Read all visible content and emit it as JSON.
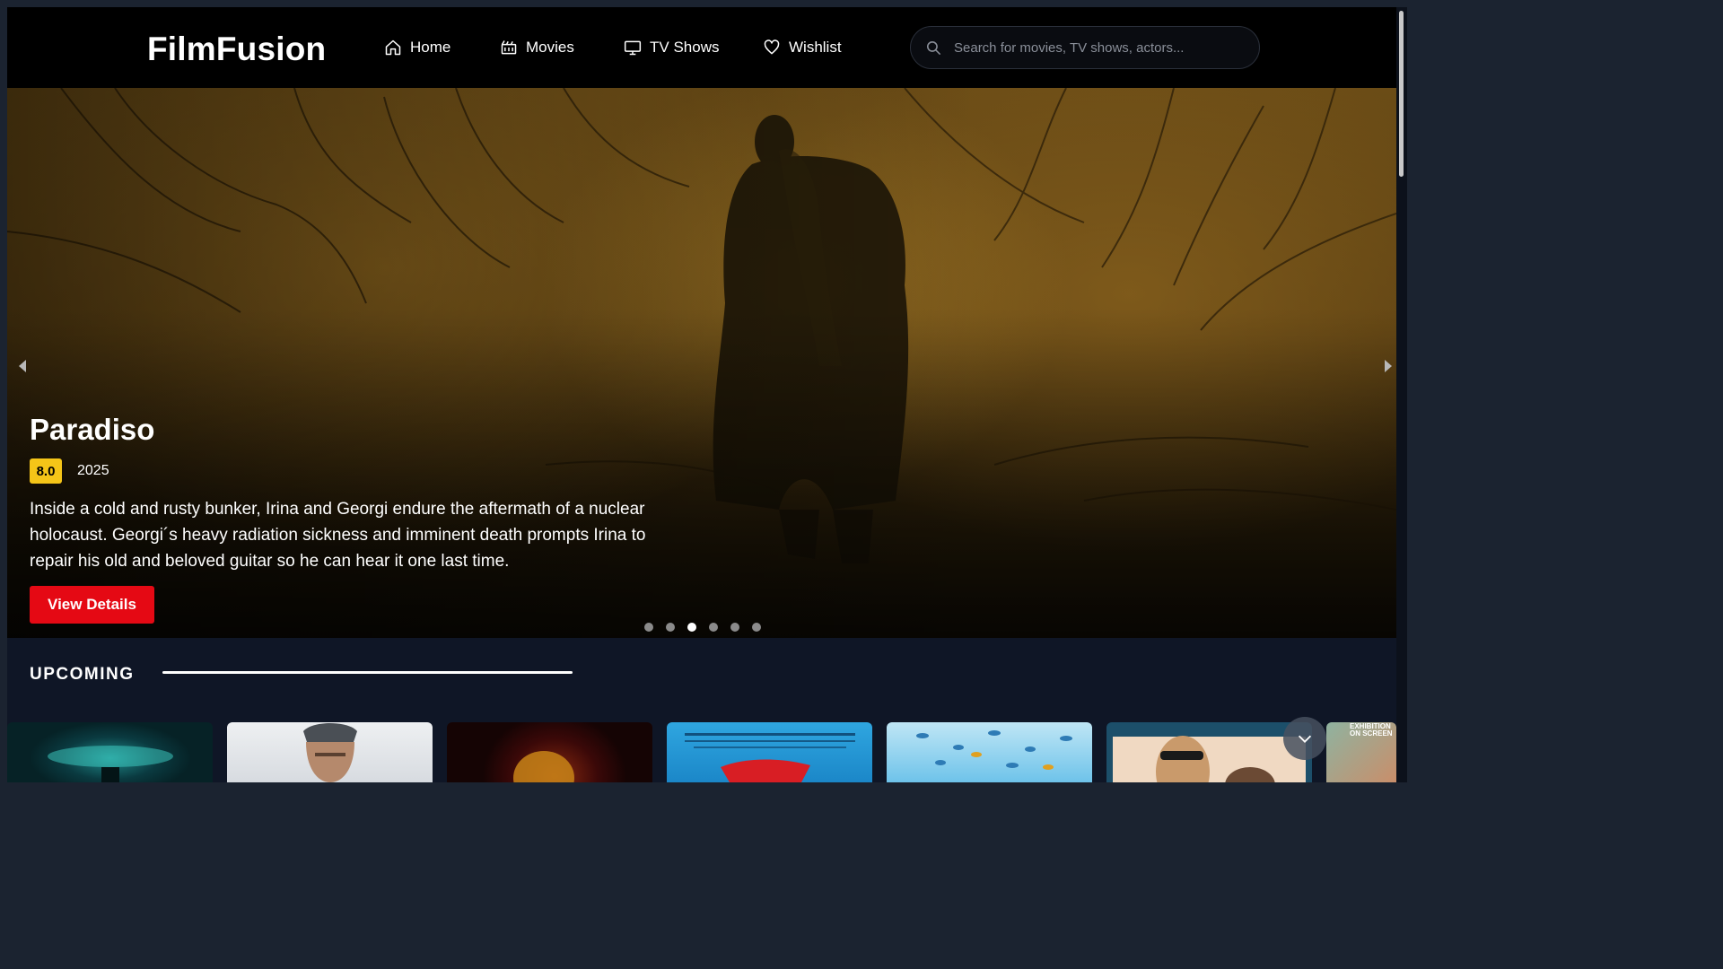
{
  "brand": {
    "logo": "FilmFusion"
  },
  "nav": {
    "items": [
      {
        "label": "Home",
        "icon": "home-icon"
      },
      {
        "label": "Movies",
        "icon": "movie-icon"
      },
      {
        "label": "TV Shows",
        "icon": "tv-icon"
      },
      {
        "label": "Wishlist",
        "icon": "heart-icon"
      }
    ],
    "search_placeholder": "Search for movies, TV shows, actors..."
  },
  "hero": {
    "title": "Paradiso",
    "rating": "8.0",
    "year": "2025",
    "description": "Inside a cold and rusty bunker, Irina and Georgi endure the aftermath of a nuclear holocaust. Georgi´s heavy radiation sickness and imminent death prompts Irina to repair his old and beloved guitar so he can hear it one last time.",
    "button_label": "View Details",
    "slides_total": 6,
    "active_slide": 3
  },
  "upcoming": {
    "title": "UPCOMING",
    "cards": [
      {
        "poster_text": ""
      },
      {
        "poster_text": ""
      },
      {
        "poster_text": ""
      },
      {
        "poster_text": ""
      },
      {
        "poster_text": ""
      },
      {
        "poster_text": ""
      },
      {
        "poster_text": "EXHIBITION ON SCREEN"
      }
    ]
  },
  "colors": {
    "accent_red": "#e50914",
    "rating_yellow": "#f5c518",
    "page_bg": "#0f1626",
    "nav_bg": "#000000"
  }
}
